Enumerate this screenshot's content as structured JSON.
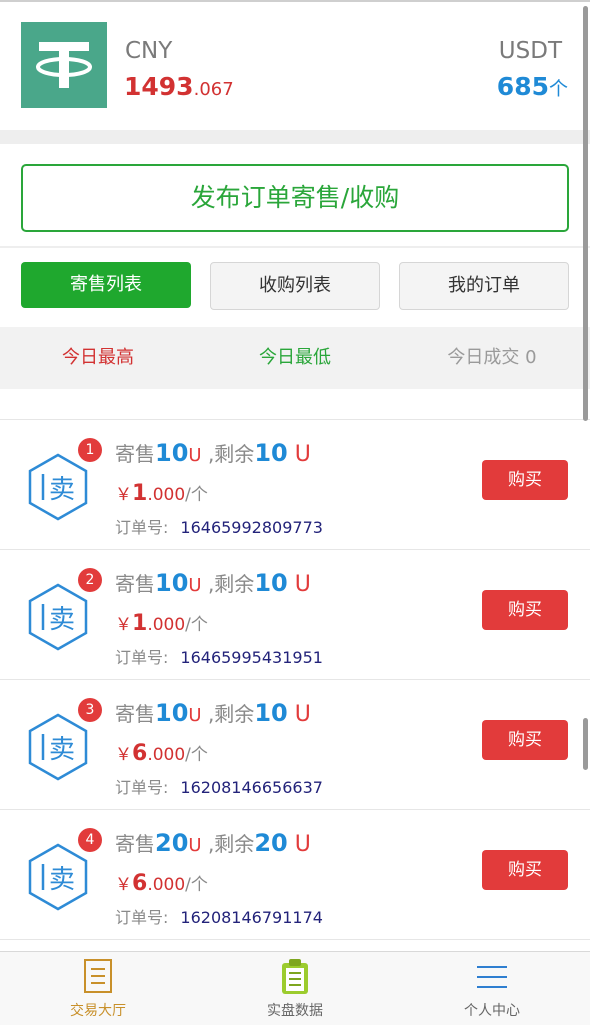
{
  "header": {
    "cny_label": "CNY",
    "cny_int": "1493",
    "cny_frac": ".067",
    "usdt_label": "USDT",
    "usdt_value": "685",
    "usdt_unit": "个",
    "logo_icon": "tether-logo-icon",
    "logo_color": "#4aa78a"
  },
  "publish_label": "发布订单寄售/收购",
  "tabs": [
    {
      "label": "寄售列表",
      "active": true
    },
    {
      "label": "收购列表",
      "active": false
    },
    {
      "label": "我的订单",
      "active": false
    }
  ],
  "stats": {
    "high": "今日最高",
    "low": "今日最低",
    "volume": "今日成交 0"
  },
  "orders": [
    {
      "badge": "1",
      "sell_prefix": "寄售",
      "sell_amount": "10",
      "sell_unit": "U",
      "remain_prefix": " ,剩余",
      "remain_amount": "10",
      "remain_unit": " U",
      "currency": "￥",
      "price_int": "1",
      "price_frac": ".000",
      "per": "/个",
      "order_label": "订单号:",
      "order_no": "16465992809773",
      "buy_label": "购买",
      "icon": "sell-hex-icon",
      "icon_char": "卖"
    },
    {
      "badge": "2",
      "sell_prefix": "寄售",
      "sell_amount": "10",
      "sell_unit": "U",
      "remain_prefix": " ,剩余",
      "remain_amount": "10",
      "remain_unit": " U",
      "currency": "￥",
      "price_int": "1",
      "price_frac": ".000",
      "per": "/个",
      "order_label": "订单号:",
      "order_no": "16465995431951",
      "buy_label": "购买",
      "icon": "sell-hex-icon",
      "icon_char": "卖"
    },
    {
      "badge": "3",
      "sell_prefix": "寄售",
      "sell_amount": "10",
      "sell_unit": "U",
      "remain_prefix": " ,剩余",
      "remain_amount": "10",
      "remain_unit": " U",
      "currency": "￥",
      "price_int": "6",
      "price_frac": ".000",
      "per": "/个",
      "order_label": "订单号:",
      "order_no": "16208146656637",
      "buy_label": "购买",
      "icon": "sell-hex-icon",
      "icon_char": "卖"
    },
    {
      "badge": "4",
      "sell_prefix": "寄售",
      "sell_amount": "20",
      "sell_unit": "U",
      "remain_prefix": " ,剩余",
      "remain_amount": "20",
      "remain_unit": " U",
      "currency": "￥",
      "price_int": "6",
      "price_frac": ".000",
      "per": "/个",
      "order_label": "订单号:",
      "order_no": "16208146791174",
      "buy_label": "购买",
      "icon": "sell-hex-icon",
      "icon_char": "卖"
    }
  ],
  "nav": [
    {
      "label": "交易大厅",
      "icon": "document-list-icon",
      "active": true
    },
    {
      "label": "实盘数据",
      "icon": "clipboard-icon",
      "active": false
    },
    {
      "label": "个人中心",
      "icon": "menu-lines-icon",
      "active": false
    }
  ],
  "colors": {
    "accent_green": "#2aa63a",
    "price_red": "#d23232",
    "value_blue": "#1f8ad6",
    "buy_red": "#e23b3b"
  }
}
